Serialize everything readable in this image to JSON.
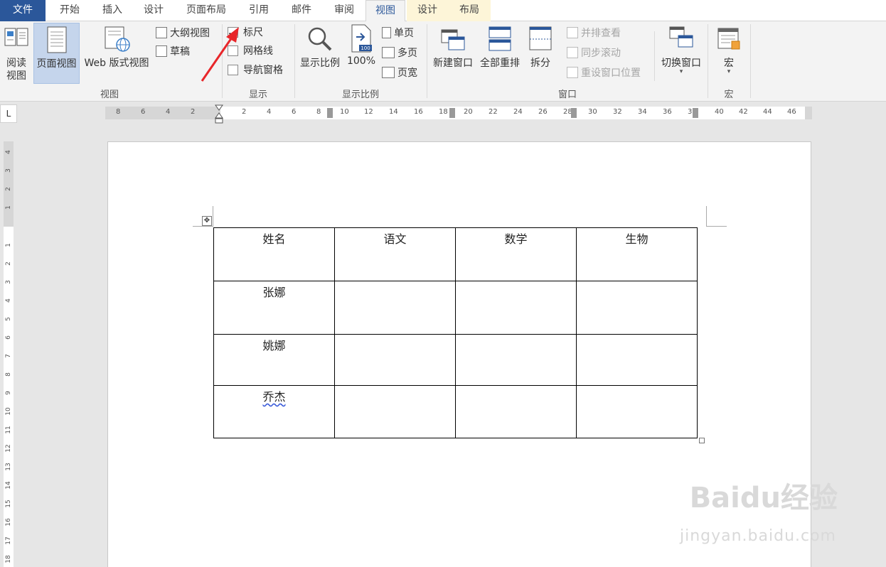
{
  "tabs": [
    "文件",
    "开始",
    "插入",
    "设计",
    "页面布局",
    "引用",
    "邮件",
    "审阅",
    "视图",
    "设计",
    "布局"
  ],
  "ribbon": {
    "views": {
      "read_mode": "阅读视图",
      "read_mode_line1": "阅读",
      "read_mode_line2": "视图",
      "print_layout": "页面视图",
      "web_layout": "Web 版式视图",
      "outline": "大纲视图",
      "draft": "草稿",
      "group": "视图"
    },
    "show": {
      "ruler": "标尺",
      "ruler_checked": true,
      "gridlines": "网格线",
      "gridlines_checked": false,
      "nav_pane": "导航窗格",
      "nav_pane_checked": false,
      "group": "显示"
    },
    "zoom": {
      "zoom": "显示比例",
      "hundred": "100%",
      "one_page": "单页",
      "multi_page": "多页",
      "page_width": "页宽",
      "group": "显示比例"
    },
    "window": {
      "new_window": "新建窗口",
      "arrange_all": "全部重排",
      "split": "拆分",
      "side_by_side": "并排查看",
      "sync_scroll": "同步滚动",
      "reset_position": "重设窗口位置",
      "switch_window": "切换窗口",
      "group": "窗口"
    },
    "macros": {
      "macros": "宏",
      "group": "宏"
    }
  },
  "ruler": {
    "corner": "L",
    "h_ticks": [
      "8",
      "6",
      "4",
      "2",
      "2",
      "4",
      "6",
      "8",
      "10",
      "12",
      "14",
      "16",
      "18",
      "20",
      "22",
      "24",
      "26",
      "28",
      "30",
      "32",
      "34",
      "36",
      "38",
      "40",
      "42",
      "44",
      "46"
    ],
    "v_ticks": [
      "4",
      "3",
      "2",
      "1",
      "1",
      "2",
      "3",
      "4",
      "5",
      "6",
      "7",
      "8",
      "9",
      "10",
      "11",
      "12",
      "13",
      "14",
      "15",
      "16",
      "17",
      "18"
    ]
  },
  "table": {
    "headers": [
      "姓名",
      "语文",
      "数学",
      "生物"
    ],
    "rows": [
      [
        "张娜",
        "",
        "",
        ""
      ],
      [
        "姚娜",
        "",
        "",
        ""
      ],
      [
        "乔杰",
        "",
        "",
        ""
      ]
    ]
  },
  "watermark": {
    "brand": "Baidu经验",
    "url": "jingyan.baidu.com"
  },
  "colors": {
    "file_tab": "#2b579a",
    "active_tab_text": "#2b579a",
    "annotation_arrow": "#e8262a",
    "selected_button": "#c5d5ec"
  }
}
